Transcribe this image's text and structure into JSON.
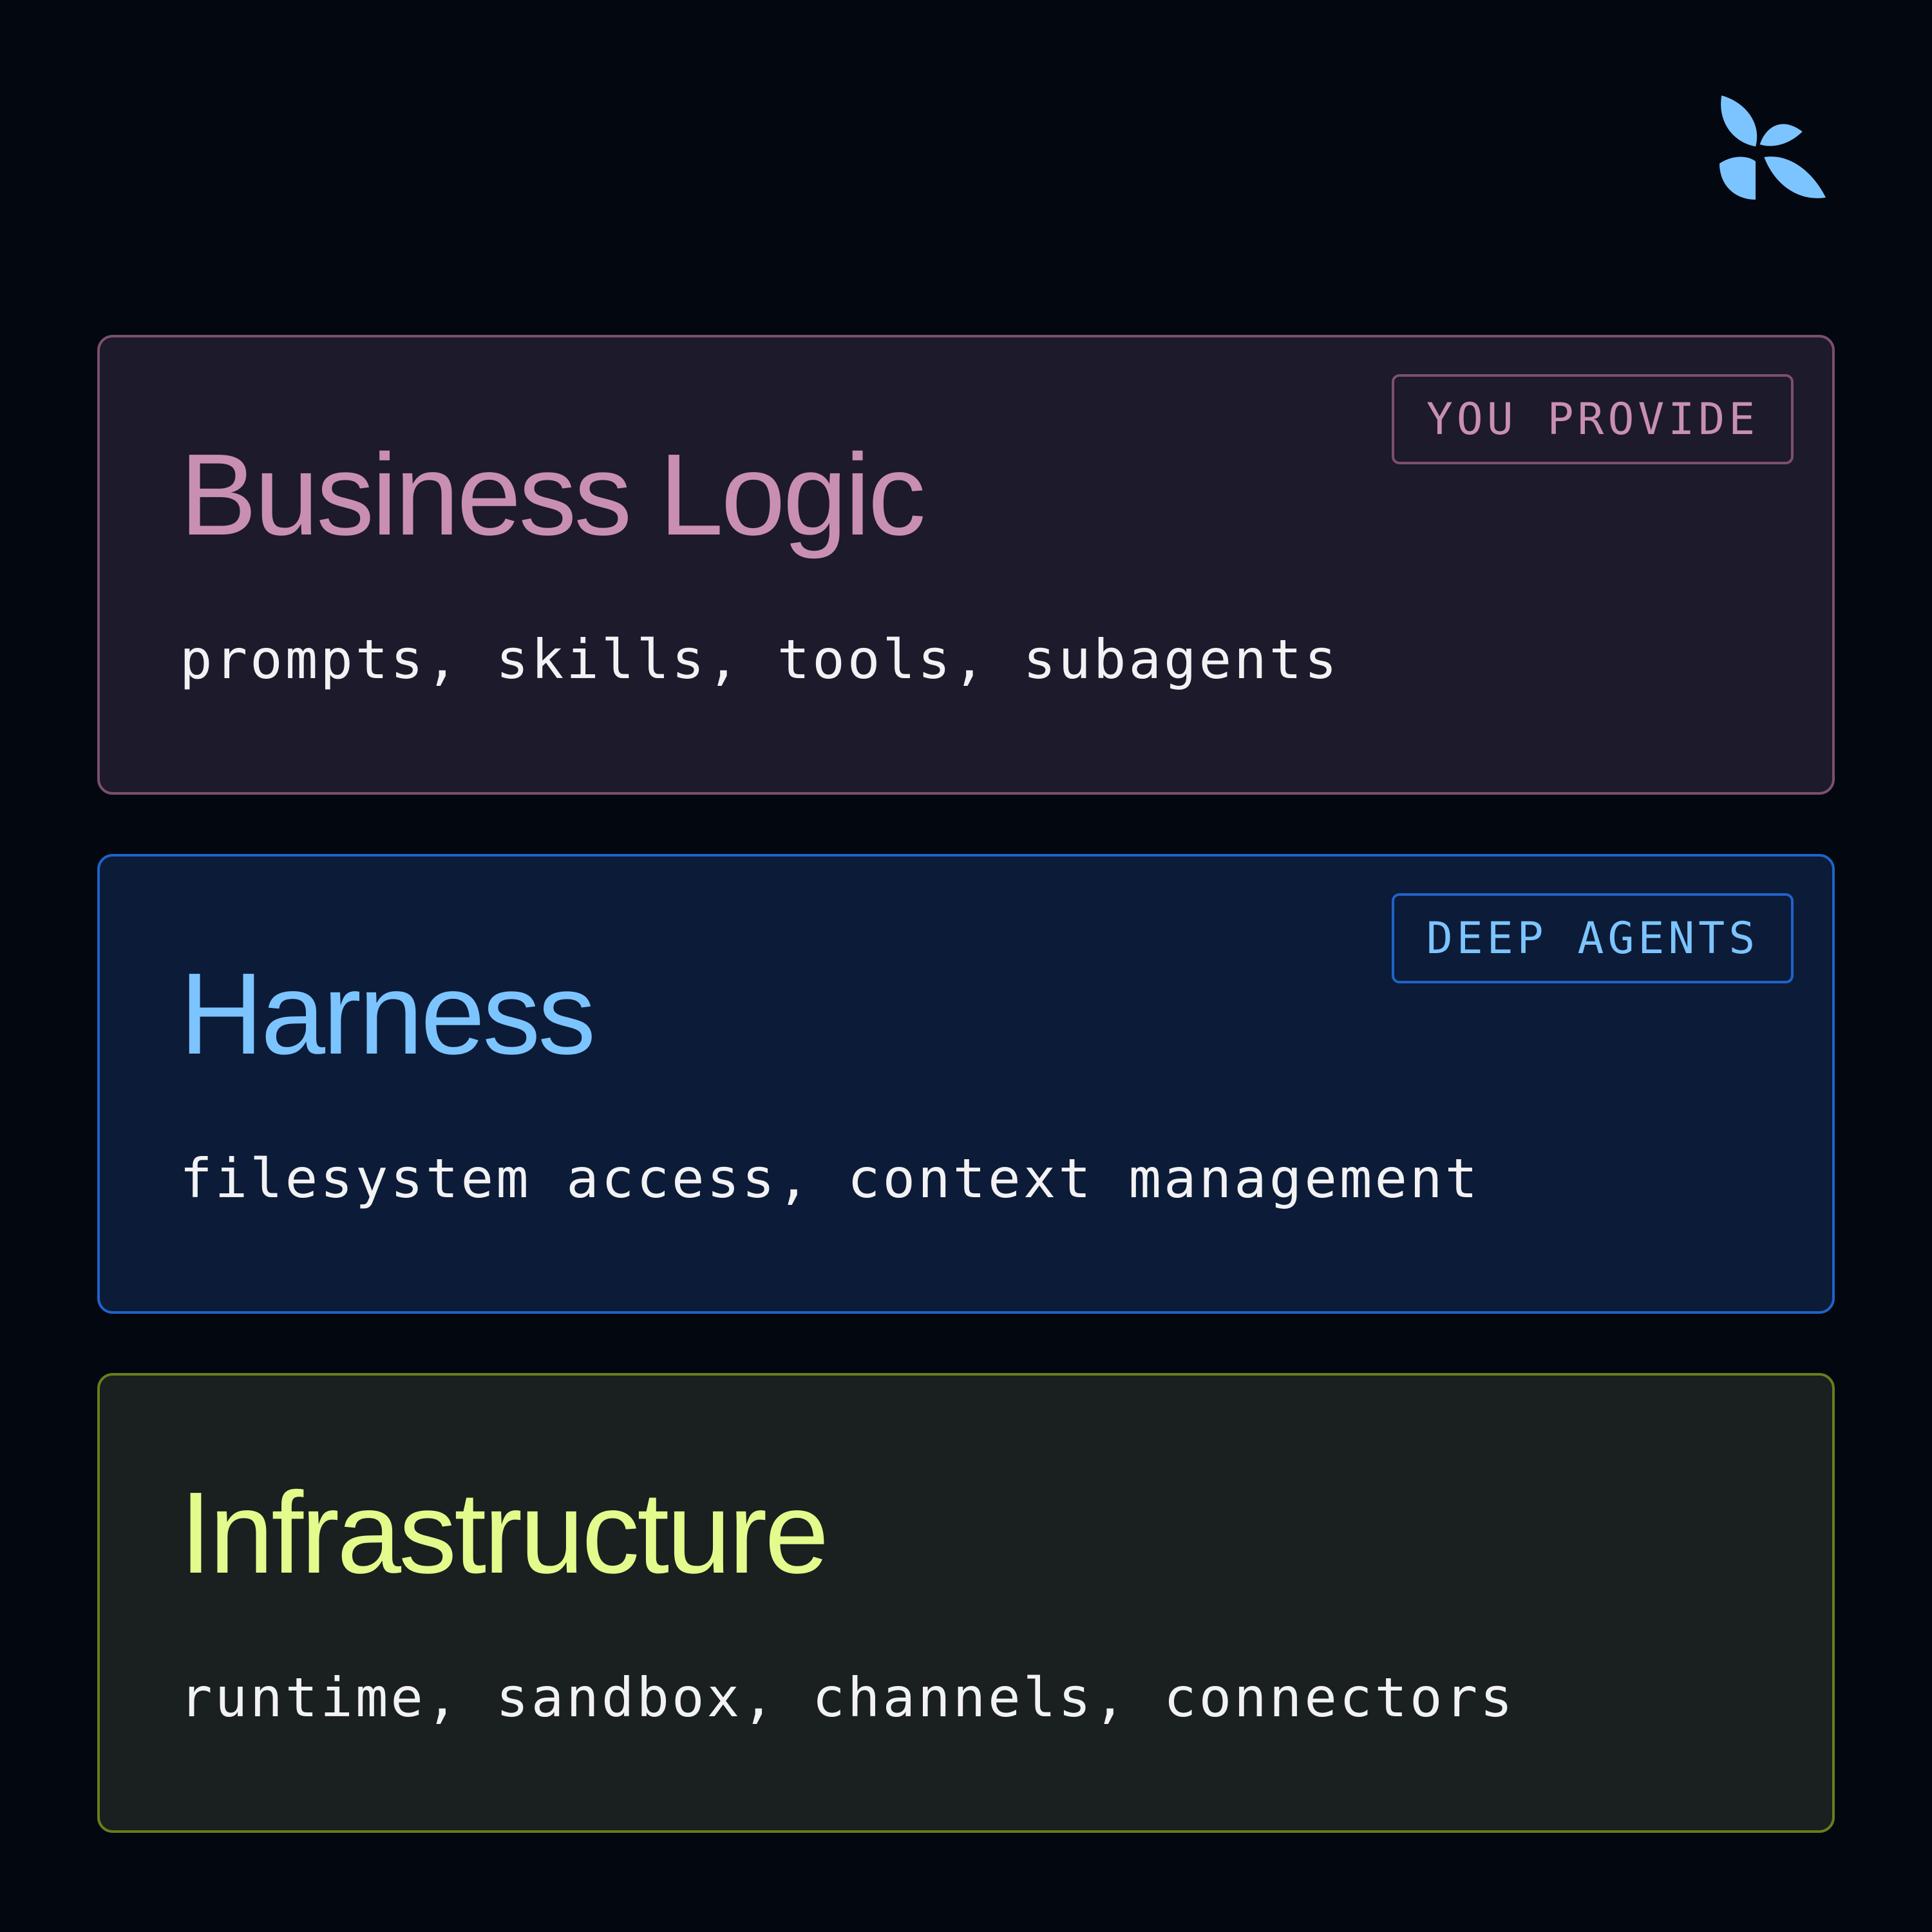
{
  "logo": {
    "icon": "leaf-petals-logo",
    "color": "#7cc4ff"
  },
  "cards": [
    {
      "title": "Business Logic",
      "description": "prompts, skills, tools, subagents",
      "badge": "YOU PROVIDE",
      "title_color": "#c98fb3",
      "border_color": "#7d4f6e",
      "background_color": "#1c1a2b"
    },
    {
      "title": "Harness",
      "description": "filesystem access, context management",
      "badge": "DEEP AGENTS",
      "title_color": "#7cc4ff",
      "border_color": "#1f63c9",
      "background_color": "#0c1b37"
    },
    {
      "title": "Infrastructure",
      "description": "runtime, sandbox, channels, connectors",
      "badge": "",
      "title_color": "#e2fb8c",
      "border_color": "#6a7d1c",
      "background_color": "#1a1f20"
    }
  ]
}
